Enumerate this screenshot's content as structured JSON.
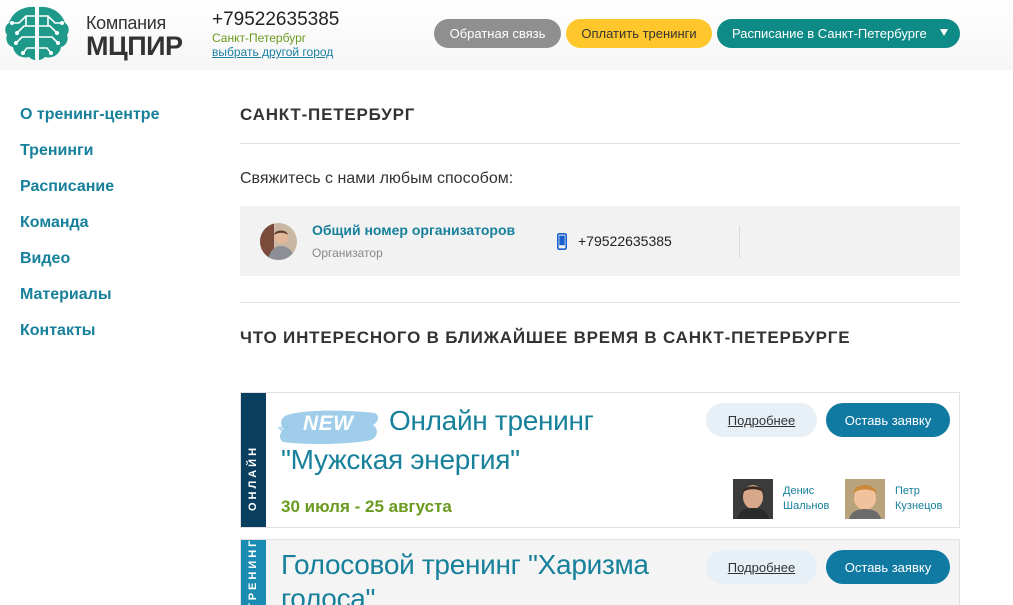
{
  "header": {
    "brand_small": "Компания",
    "brand_big": "МЦПИР",
    "phone": "+79522635385",
    "city": "Санкт-Петербург",
    "change_city": "выбрать другой город",
    "feedback_label": "Обратная связь",
    "pay_label": "Оплатить тренинги",
    "schedule_label": "Расписание в Санкт-Петербурге"
  },
  "sidebar": {
    "items": [
      {
        "label": "О тренинг-центре"
      },
      {
        "label": "Тренинги"
      },
      {
        "label": "Расписание"
      },
      {
        "label": "Команда"
      },
      {
        "label": "Видео"
      },
      {
        "label": "Материалы"
      },
      {
        "label": "Контакты"
      }
    ]
  },
  "main": {
    "city_heading": "САНКТ-ПЕТЕРБУРГ",
    "contact_intro": "Свяжитесь с нами любым способом:",
    "contact": {
      "name": "Общий номер организаторов",
      "role": "Организатор",
      "phone": "+79522635385"
    },
    "upcoming_heading": "ЧТО ИНТЕРЕСНОГО В БЛИЖАЙШЕЕ ВРЕМЯ В САНКТ-ПЕТЕРБУРГЕ",
    "trainings": [
      {
        "ribbon": "ОНЛАЙН",
        "badge": "NEW",
        "title_line1": "Онлайн тренинг",
        "title_line2": "\"Мужская энергия\"",
        "dates": "30 июля - 25 августа",
        "more_label": "Подробнее",
        "apply_label": "Оставь заявку",
        "trainers": [
          {
            "first": "Денис",
            "last": "Шальнов"
          },
          {
            "first": "Петр",
            "last": "Кузнецов"
          }
        ]
      },
      {
        "ribbon": "ТРЕНИНГ",
        "title": "Голосовой тренинг \"Харизма голоса\"",
        "more_label": "Подробнее",
        "apply_label": "Оставь заявку"
      }
    ]
  },
  "colors": {
    "accent": "#17809b",
    "teal": "#0e8a87",
    "yellow": "#ffc72c",
    "green": "#6a9a1f",
    "apply_blue": "#107aa3"
  }
}
